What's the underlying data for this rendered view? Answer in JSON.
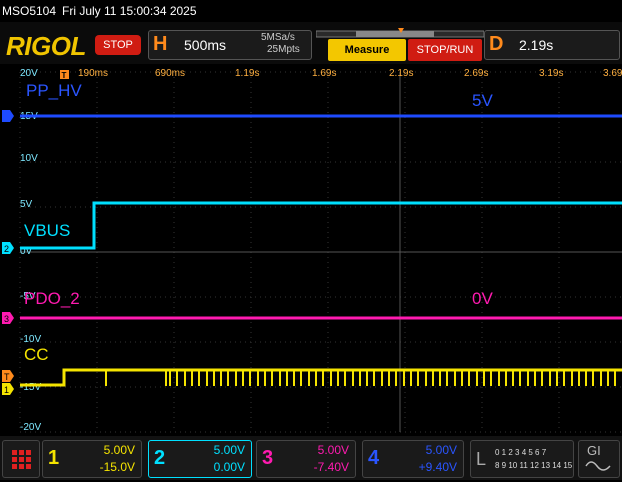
{
  "info": {
    "model": "MSO5104",
    "datetime": "Fri July 11 15:00:34 2025"
  },
  "header": {
    "logo": "RIGOL",
    "run_state": "STOP",
    "horizontal": {
      "letter": "H",
      "timebase": "500ms",
      "sample_rate": "5MSa/s",
      "memory": "25Mpts"
    },
    "measure_label": "Measure",
    "stoprun_label": "STOP/RUN",
    "delay": {
      "letter": "D",
      "value": "2.19s"
    }
  },
  "time_ticks": [
    "190ms",
    "690ms",
    "1.19s",
    "1.69s",
    "2.19s",
    "2.69s",
    "3.19s",
    "3.69s"
  ],
  "volt_ticks": [
    "20V",
    "15V",
    "10V",
    "5V",
    "0V",
    "-5V",
    "-10V",
    "-15V",
    "-20V"
  ],
  "trace_labels": {
    "ch4_name": "PP_HV",
    "ch4_value": "5V",
    "ch2_name": "VBUS",
    "ch3_name": "PDO_2",
    "ch3_value": "0V",
    "ch1_name": "CC"
  },
  "channels": [
    {
      "num": "1",
      "scale": "5.00V",
      "offset": "-15.0V",
      "color": "#f5e400"
    },
    {
      "num": "2",
      "scale": "5.00V",
      "offset": "0.00V",
      "color": "#00e0ff"
    },
    {
      "num": "3",
      "scale": "5.00V",
      "offset": "-7.40V",
      "color": "#ff1ab0"
    },
    {
      "num": "4",
      "scale": "5.00V",
      "offset": "+9.40V",
      "color": "#1e4bff"
    }
  ],
  "digital": {
    "letter": "L",
    "row1": "0 1 2 3 4 5 6 7",
    "row2": "8 9 10 11 12 13 14 15"
  },
  "colors": {
    "ch1": "#f5e400",
    "ch2": "#00e0ff",
    "ch3": "#ff1ab0",
    "ch4": "#1e4bff",
    "brand": "#f0c400",
    "stop": "#d01c12"
  }
}
